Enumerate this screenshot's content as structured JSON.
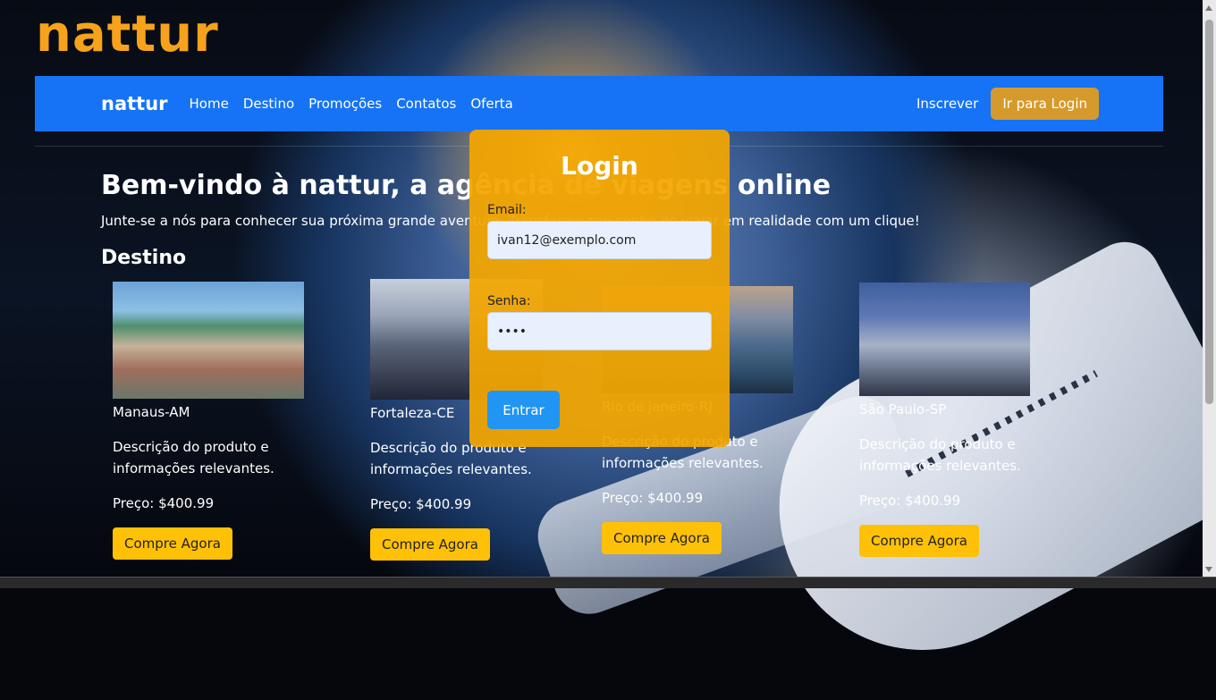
{
  "brand": "nattur",
  "navbar": {
    "brand": "nattur",
    "links": [
      "Home",
      "Destino",
      "Promoções",
      "Contatos",
      "Oferta"
    ],
    "subscribe": "Inscrever",
    "login_button": "Ir para Login"
  },
  "hero": {
    "title": "Bem-vindo à nattur, a agência de viagens online",
    "subtitle": "Junte-se a nós para conhecer sua próxima grande aventura. Transforme seu sonho de viajar em realidade com um clique!"
  },
  "section_title": "Destino",
  "cards": [
    {
      "name": "Manaus-AM",
      "desc": "Descrição do produto e informações relevantes.",
      "price": "Preço: $400.99",
      "button": "Compre Agora"
    },
    {
      "name": "Fortaleza-CE",
      "desc": "Descrição do produto e informações relevantes.",
      "price": "Preço: $400.99",
      "button": "Compre Agora"
    },
    {
      "name": "Rio de janeiro-RJ",
      "desc": "Descrição do produto e informações relevantes.",
      "price": "Preço: $400.99",
      "button": "Compre Agora"
    },
    {
      "name": "São Paulo-SP",
      "desc": "Descrição do produto e informações relevantes.",
      "price": "Preço: $400.99",
      "button": "Compre Agora"
    }
  ],
  "login": {
    "title": "Login",
    "email_label": "Email:",
    "email_value": "ivan12@exemplo.com",
    "password_label": "Senha:",
    "password_value": "1234",
    "submit": "Entrar"
  },
  "colors": {
    "brand_orange": "#f7a21b",
    "navbar_blue": "#1673f6",
    "login_panel": "#f3a600",
    "buy_button": "#ffc107",
    "enter_button": "#2095f3"
  }
}
